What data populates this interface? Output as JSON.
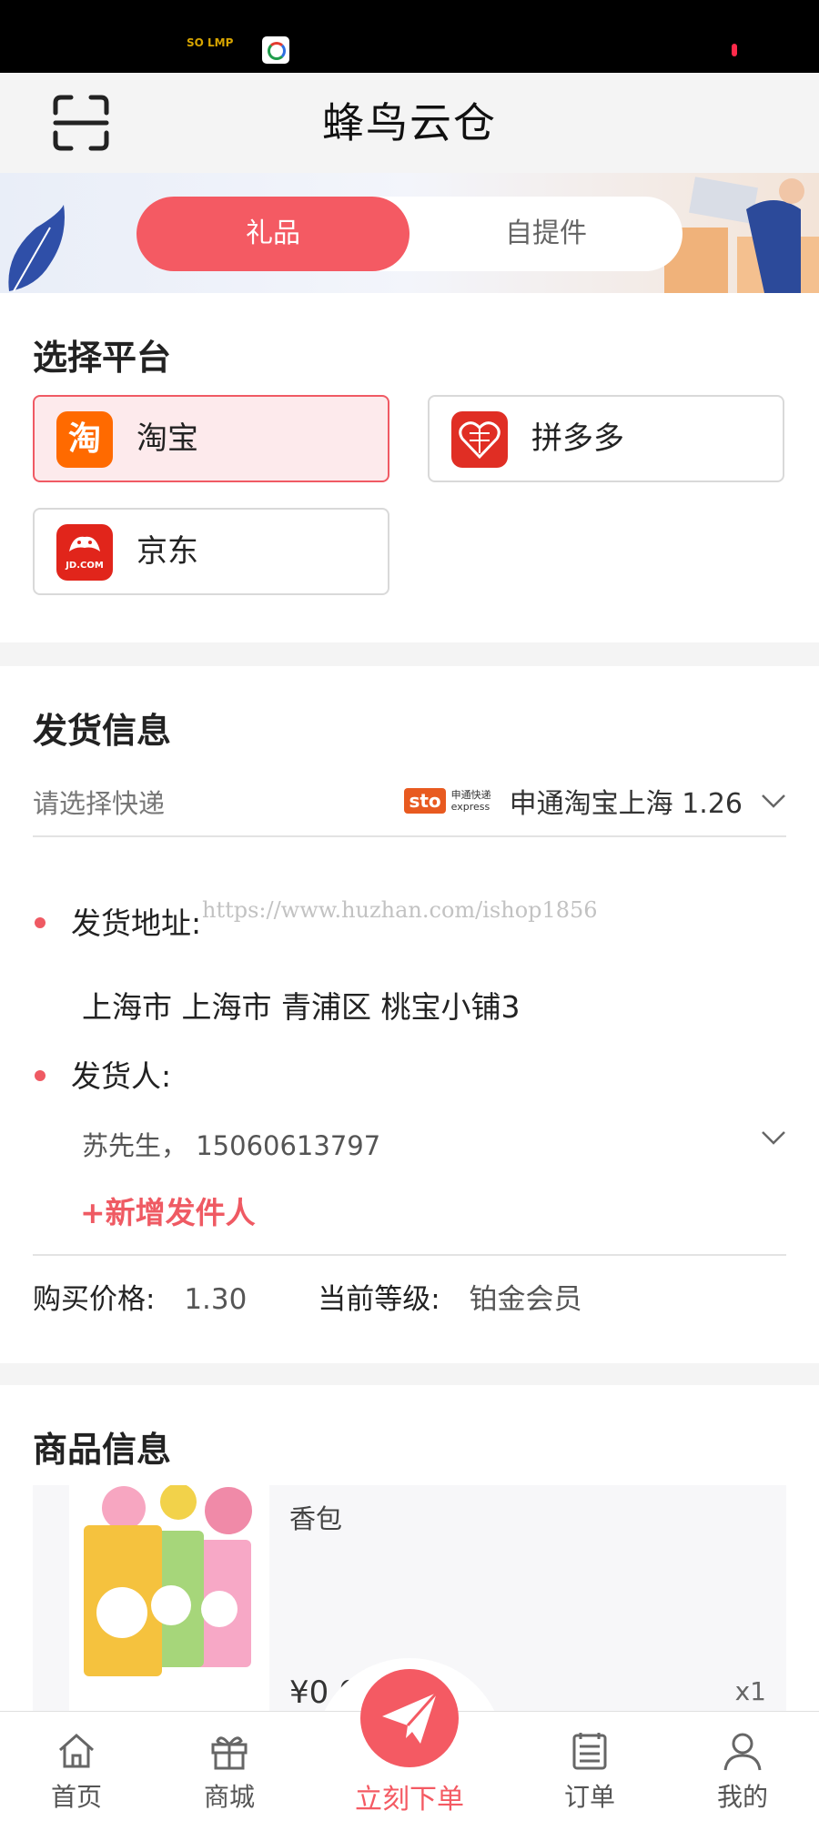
{
  "status_bar": {
    "left_logo_text": "SO LMP",
    "app_icon": "browser-app-icon",
    "indicator_color": "#ff2a4a"
  },
  "header": {
    "title": "蜂鸟云仓",
    "scan_icon": "scan-icon"
  },
  "mode_tabs": [
    {
      "label": "礼品",
      "active": true
    },
    {
      "label": "自提件",
      "active": false
    }
  ],
  "platform_section": {
    "title": "选择平台",
    "platforms": [
      {
        "label": "淘宝",
        "icon": "taobao-icon",
        "icon_glyph": "淘",
        "color": "#ff6a00",
        "selected": true
      },
      {
        "label": "拼多多",
        "icon": "pinduoduo-icon",
        "color": "#e02e24",
        "selected": false
      },
      {
        "label": "京东",
        "icon": "jd-icon",
        "icon_glyph": "JD.COM",
        "color": "#e1251b",
        "selected": false
      }
    ]
  },
  "shipping_section": {
    "title": "发货信息",
    "courier_label": "请选择快递",
    "courier_logo_badge": "sto",
    "courier_logo_cn": "申通快递",
    "courier_logo_en": "express",
    "courier_value": "申通淘宝上海 1.26",
    "address_label": "发货地址:",
    "address_value": "上海市 上海市 青浦区 桃宝小铺3",
    "sender_label": "发货人:",
    "sender_value": "苏先生， 15060613797",
    "add_sender": "+新增发件人",
    "watermark": "https://www.huzhan.com/ishop1856",
    "price_label": "购买价格:",
    "price_value": "1.30",
    "level_label": "当前等级:",
    "level_value": "铂金会员"
  },
  "goods_section": {
    "title": "商品信息",
    "item": {
      "name": "香包",
      "price": "¥0.0",
      "qty": "x1"
    }
  },
  "tabbar": {
    "active_color": "#f45a63",
    "items": [
      {
        "label": "首页",
        "icon": "home-icon"
      },
      {
        "label": "商城",
        "icon": "gift-icon"
      },
      {
        "label": "立刻下单",
        "icon": "send-icon"
      },
      {
        "label": "订单",
        "icon": "orders-icon"
      },
      {
        "label": "我的",
        "icon": "user-icon"
      }
    ]
  }
}
